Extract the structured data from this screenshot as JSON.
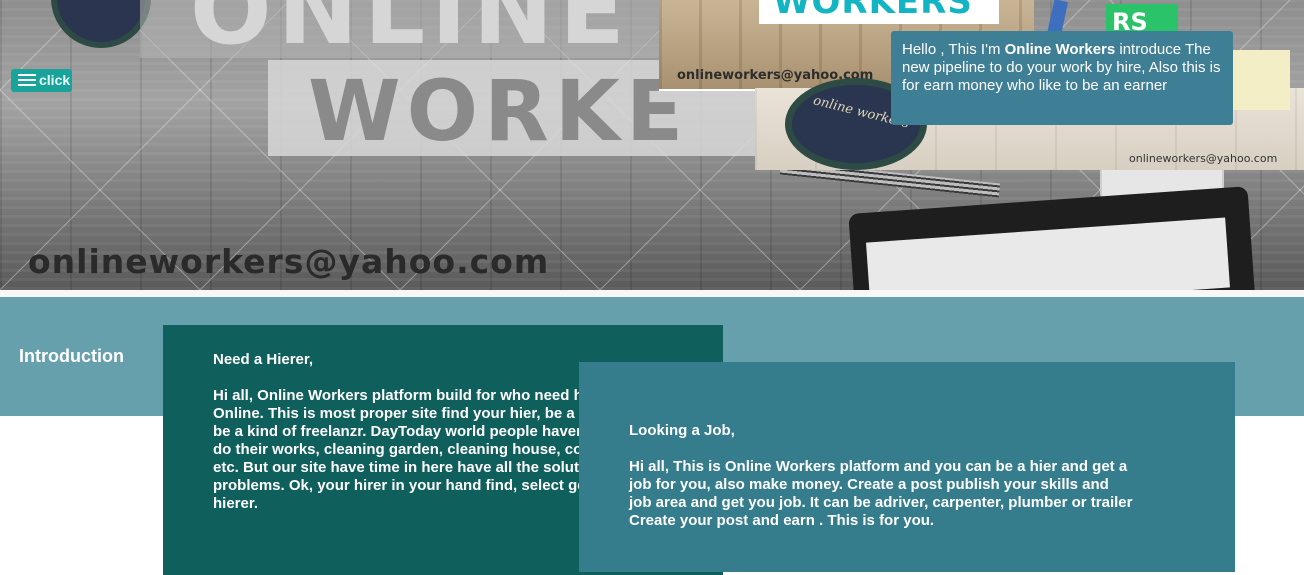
{
  "hero": {
    "big_word_top": "ONLINE",
    "big_word_bottom": "WORKE",
    "email_large": "onlineworkers@yahoo.com",
    "inset_top_banner": "WORKERS",
    "inset_top_email": "onlineworkers@yahoo.com",
    "inset_green_text": "RS",
    "inset_mid_logo_text": "online workers",
    "inset_mid_email": "onlineworkers@yahoo.com"
  },
  "intro_popup": {
    "prefix": "Hello , This I'm ",
    "brand": "Online Workers",
    "suffix": " introduce The new pipeline to do your work by hire, Also this is for earn money who like to be an earner"
  },
  "menu": {
    "label": "click",
    "icon": "hamburger-icon"
  },
  "section": {
    "heading": "Introduction"
  },
  "cards": {
    "hire": {
      "title": "Need a Hierer,",
      "body": "Hi all, Online Workers platform build for who need help in Online. This is most proper site find your hier, be a hier. Its can be a kind of freelanzr. DayToday world people haven't lot of time do their works, cleaning garden, cleaning house, colorwashing etc. But our site have time in here have all the solution for your problems. Ok, your hirer in your hand find, select get your hierer."
    },
    "job": {
      "title": "Looking a Job,",
      "body": "Hi all, This is Online Workers platform and you can be a hier and get a job for you, also make money. Create a post publish your skills and job area and get you job. It can be adriver, carpenter, plumber or trailer Create your post and earn . This is for you."
    }
  },
  "colors": {
    "intro_band": "#67a0ad",
    "card_hire": "#0f5f5c",
    "card_job": "#357d8c",
    "intro_popup": "#3f7f96",
    "menu_button": "#1aa39b"
  }
}
